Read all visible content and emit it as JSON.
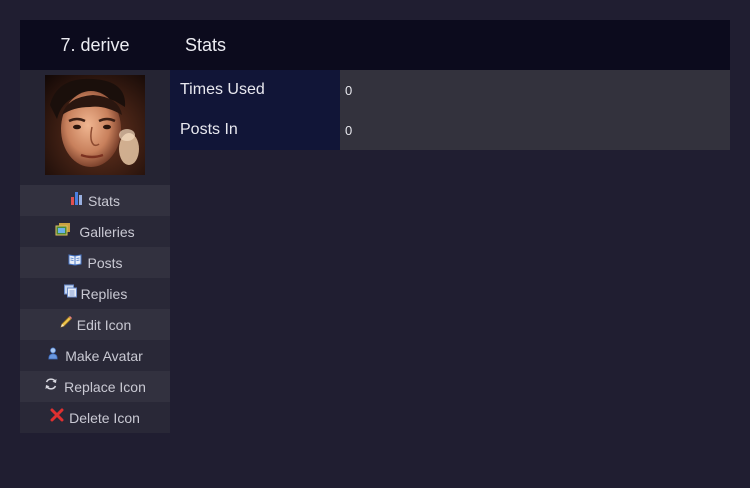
{
  "header": {
    "icon_title": "7. derive",
    "section_title": "Stats"
  },
  "avatar": {
    "icon": "portrait-photo-icon"
  },
  "menu": {
    "items": [
      {
        "label": "Stats",
        "icon": "bar-chart-icon"
      },
      {
        "label": "Galleries",
        "icon": "gallery-icon"
      },
      {
        "label": "Posts",
        "icon": "open-book-icon"
      },
      {
        "label": "Replies",
        "icon": "stacked-pages-icon"
      },
      {
        "label": "Edit Icon",
        "icon": "pencil-icon"
      },
      {
        "label": "Make Avatar",
        "icon": "user-icon"
      },
      {
        "label": "Replace Icon",
        "icon": "refresh-icon"
      },
      {
        "label": "Delete Icon",
        "icon": "red-x-icon"
      }
    ]
  },
  "stats": {
    "rows": [
      {
        "label": "Times Used",
        "value": "0"
      },
      {
        "label": "Posts In",
        "value": "0"
      }
    ]
  },
  "colors": {
    "page_background": "#201e31",
    "header_background": "#0c0b1d",
    "stat_label_background": "#111537",
    "stat_value_background": "#33323d"
  }
}
